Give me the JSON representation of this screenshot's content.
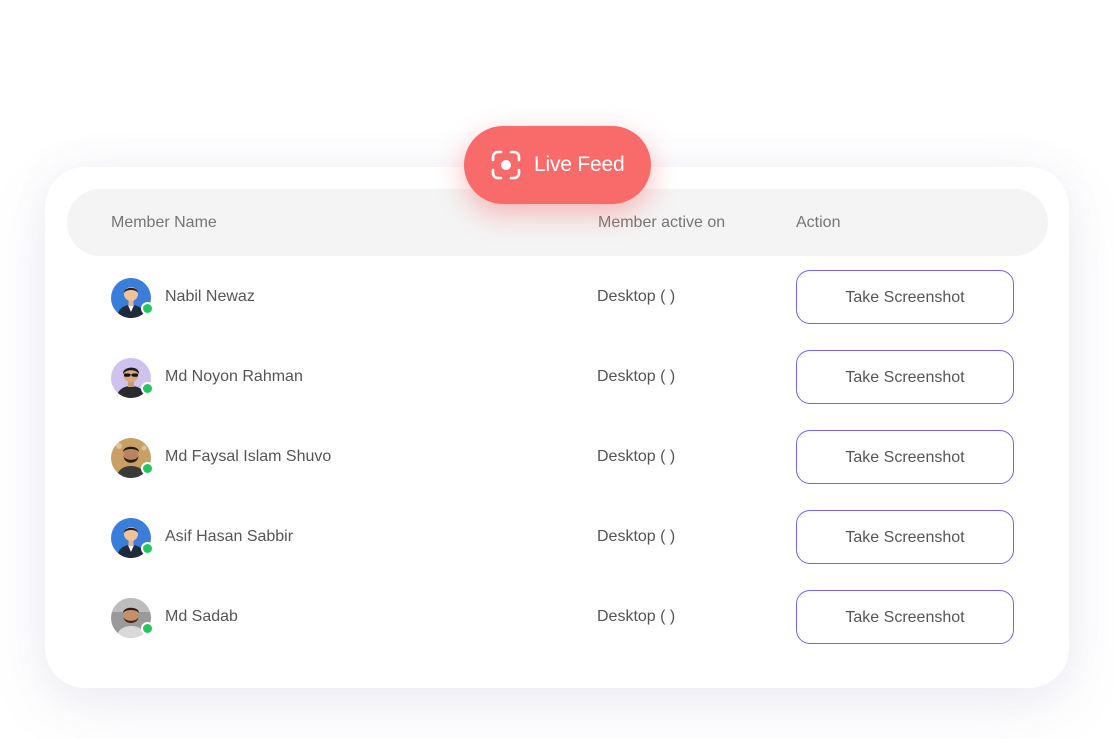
{
  "badge": {
    "icon": "focus-camera-icon",
    "label": "Live Feed",
    "color": "#f96b6b"
  },
  "table": {
    "headers": {
      "member_name": "Member Name",
      "active_on": "Member active on",
      "action": "Action"
    },
    "rows": [
      {
        "name": "Nabil Newaz",
        "device": "Desktop ( )",
        "action_label": "Take Screenshot",
        "status": "online",
        "avatar": "avatar-suit-blue"
      },
      {
        "name": "Md Noyon Rahman",
        "device": "Desktop ( )",
        "action_label": "Take Screenshot",
        "status": "online",
        "avatar": "avatar-sunglasses-lavender"
      },
      {
        "name": "Md Faysal Islam Shuvo",
        "device": "Desktop ( )",
        "action_label": "Take Screenshot",
        "status": "online",
        "avatar": "avatar-beard-tan"
      },
      {
        "name": "Asif Hasan Sabbir",
        "device": "Desktop ( )",
        "action_label": "Take Screenshot",
        "status": "online",
        "avatar": "avatar-suit-blue"
      },
      {
        "name": "Md Sadab",
        "device": "Desktop ( )",
        "action_label": "Take Screenshot",
        "status": "online",
        "avatar": "avatar-photo-grey"
      }
    ]
  },
  "colors": {
    "accent_border": "#7d5ef0",
    "online_status": "#22c55e",
    "header_bg": "#f4f4f4"
  }
}
